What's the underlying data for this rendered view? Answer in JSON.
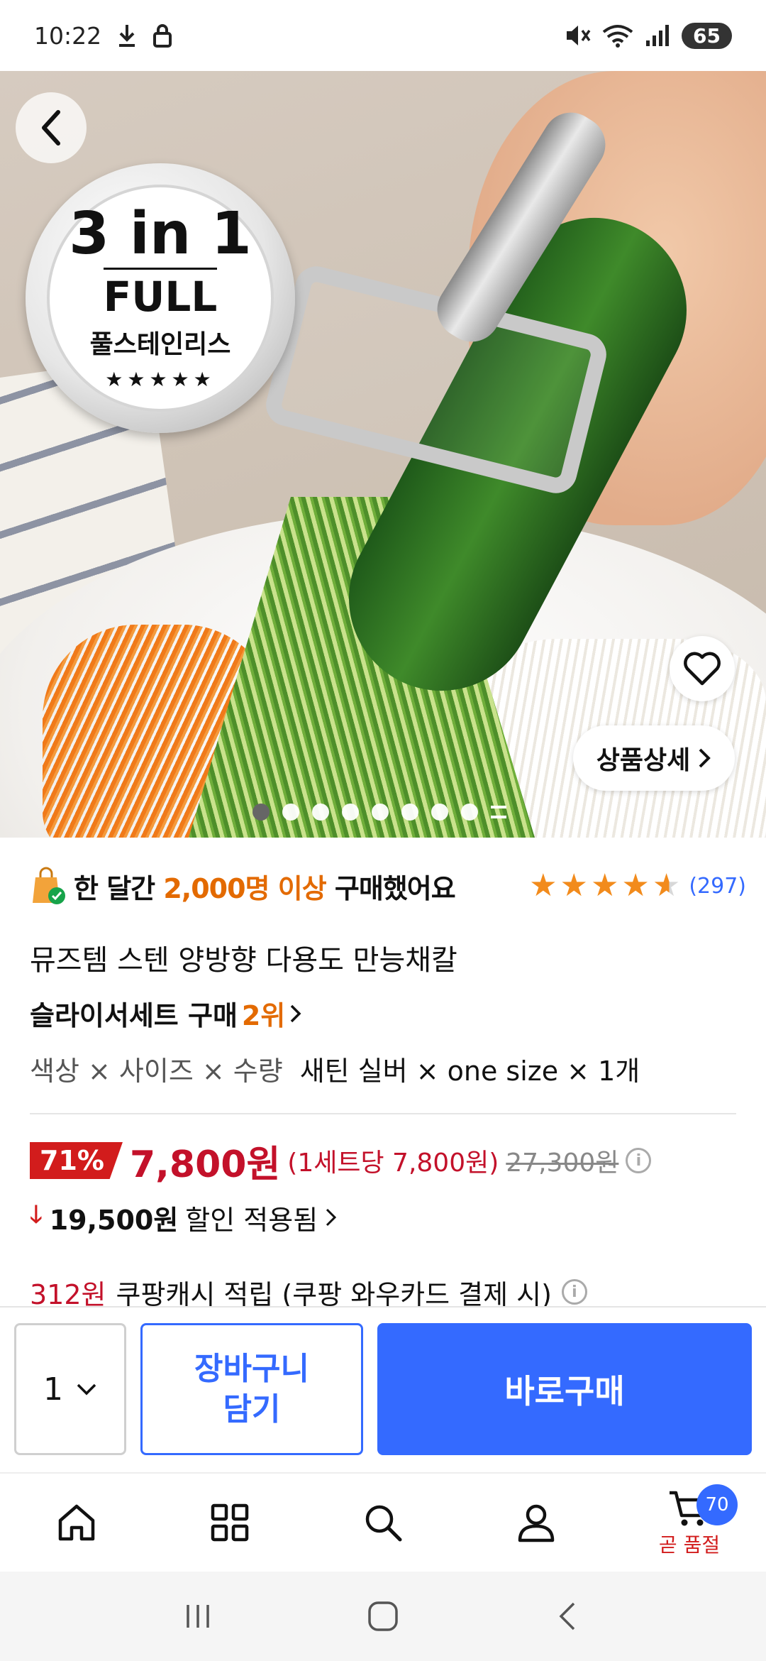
{
  "status_bar": {
    "time": "10:22",
    "battery": "65"
  },
  "hero": {
    "badge": {
      "line1": "3 in 1",
      "line2": "FULL",
      "line3": "풀스테인리스",
      "stars": "★★★★★"
    },
    "detail_button_label": "상품상세",
    "image_count": 8,
    "active_index": 0
  },
  "product": {
    "sold_prefix": "한 달간",
    "sold_count": "2,000명 이상",
    "sold_suffix": "구매했어요",
    "rating": 4.5,
    "review_count": "(297)",
    "title": "뮤즈템 스텐 양방향 다용도 만능채칼",
    "rank_category": "슬라이서세트 구매",
    "rank_number": "2위",
    "option_labels": "색상 × 사이즈 × 수량",
    "option_values": "새틴 실버 × one size × 1개",
    "discount_percent": "71%",
    "price": "7,800원",
    "unit_price": "(1세트당 7,800원)",
    "original_price": "27,300원",
    "discount_amount": "19,500원",
    "discount_text": "할인 적용됨",
    "cash_amount": "312원",
    "cash_text": "쿠팡캐시 적립 (쿠팡 와우카드 결제 시)"
  },
  "purchase_bar": {
    "quantity": "1",
    "cart_button": "장바구니\n담기",
    "buy_button": "바로구매"
  },
  "bottom_nav": {
    "cart_badge": "70",
    "cart_caption": "곧 품절"
  },
  "colors": {
    "accent_blue": "#346aff",
    "price_red": "#c3112a",
    "highlight_orange": "#e36a00",
    "star_orange": "#f28b1c"
  }
}
